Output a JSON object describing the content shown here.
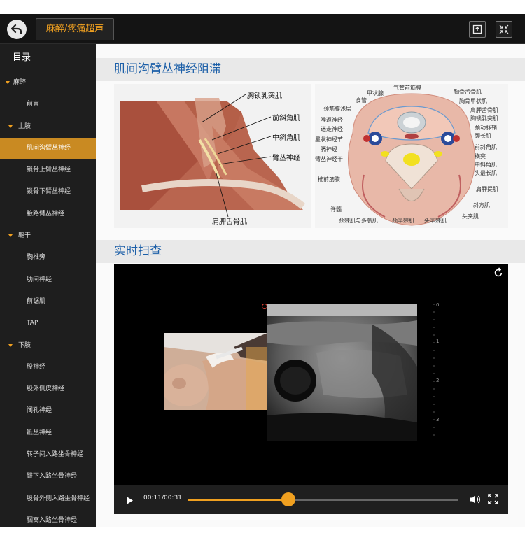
{
  "topbar": {
    "tab_label": "麻醉/疼痛超声"
  },
  "sidebar": {
    "title": "目录",
    "items": [
      {
        "label": "麻醉",
        "level": "cat",
        "expanded": true,
        "active": false
      },
      {
        "label": "前言",
        "level": "leaf",
        "active": false
      },
      {
        "label": "上肢",
        "level": "sub",
        "expanded": true,
        "active": false
      },
      {
        "label": "肌间沟臂丛神经",
        "level": "leaf",
        "active": true
      },
      {
        "label": "锁骨上臂丛神经",
        "level": "leaf",
        "active": false
      },
      {
        "label": "锁骨下臂丛神经",
        "level": "leaf",
        "active": false
      },
      {
        "label": "腋路臂丛神经",
        "level": "leaf",
        "active": false
      },
      {
        "label": "躯干",
        "level": "sub",
        "expanded": true,
        "active": false
      },
      {
        "label": "胸椎旁",
        "level": "leaf",
        "active": false
      },
      {
        "label": "肋间神经",
        "level": "leaf",
        "active": false
      },
      {
        "label": "前锯肌",
        "level": "leaf",
        "active": false
      },
      {
        "label": "TAP",
        "level": "leaf",
        "active": false
      },
      {
        "label": "下肢",
        "level": "sub",
        "expanded": true,
        "active": false
      },
      {
        "label": "股神经",
        "level": "leaf",
        "active": false
      },
      {
        "label": "股外侧皮神经",
        "level": "leaf",
        "active": false
      },
      {
        "label": "闭孔神经",
        "level": "leaf",
        "active": false
      },
      {
        "label": "骶丛神经",
        "level": "leaf",
        "active": false
      },
      {
        "label": "转子间入路坐骨神经",
        "level": "leaf",
        "active": false
      },
      {
        "label": "臀下入路坐骨神经",
        "level": "leaf",
        "active": false
      },
      {
        "label": "股骨外侧入路坐骨神经",
        "level": "leaf",
        "active": false
      },
      {
        "label": "腘窝入路坐骨神经",
        "level": "leaf",
        "active": false
      }
    ]
  },
  "main": {
    "section1_title": "肌间沟臂丛神经阻滞",
    "section2_title": "实时扫查",
    "anatomy_left_labels": {
      "l1": "胸锁乳突肌",
      "l2": "前斜角肌",
      "l3": "中斜角肌",
      "l4": "臂丛神经",
      "l5": "肩胛舌骨肌"
    },
    "anatomy_right_labels": {
      "top1": "气管前筋膜",
      "top2": "甲状腺",
      "top3": "食管",
      "r1": "胸骨舌骨肌",
      "r2": "胸骨甲状肌",
      "r3": "肩胛舌骨肌",
      "r4": "胸锁乳突肌",
      "r5": "颈动脉鞘",
      "r6": "颈长肌",
      "r7": "前斜角肌",
      "r8": "横突",
      "r9": "中斜角肌",
      "r10": "头最长肌",
      "r11": "肩胛提肌",
      "r12": "斜方肌",
      "r13": "头夹肌",
      "l1": "颈筋膜浅层",
      "l2": "喉返神经",
      "l3": "迷走神经",
      "l4": "星状神经节",
      "l5": "膈神经",
      "l6": "臂丛神经干",
      "l7": "椎前筋膜",
      "l8": "脊髓",
      "b1": "颈棘肌与多裂肌",
      "b2": "颈半棘肌",
      "b3": "头半棘肌"
    },
    "depth_scale": [
      "0",
      "1",
      "2",
      "3"
    ],
    "video": {
      "current_time": "00:11",
      "duration": "00:31",
      "progress": 0.37
    }
  },
  "colors": {
    "accent": "#f0a020",
    "title_blue": "#1c5fa8",
    "active_item": "#c98a22"
  }
}
